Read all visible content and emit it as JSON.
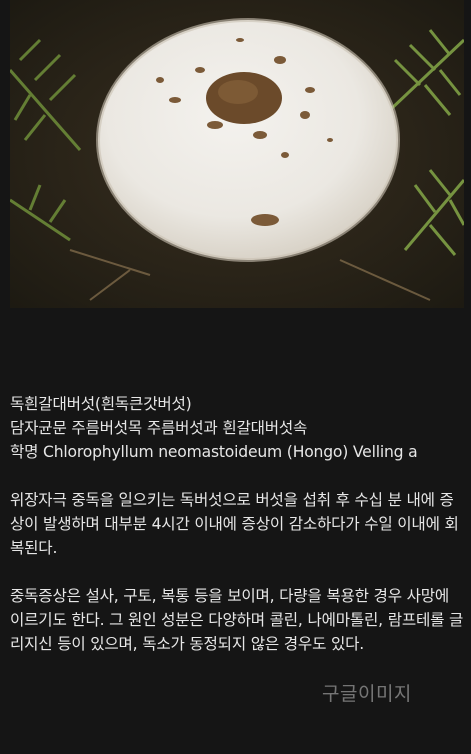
{
  "article": {
    "title": "독흰갈대버섯(흰독큰갓버섯)",
    "classification": "담자균문 주름버섯목 주름버섯과 흰갈대버섯속",
    "scientific_name": "학명 Chlorophyllum neomastoideum (Hongo) Velling a",
    "paragraphs": [
      "위장자극 중독을 일으키는 독버섯으로 버섯을 섭취 후 수십 분 내에 증상이 발생하며 대부분 4시간 이내에 증상이 감소하다가 수일 이내에 회복된다.",
      "중독증상은 설사, 구토, 복통 등을 보이며, 다량을 복용한 경우 사망에 이르기도 한다. 그 원인 성분은 다양하며 콜린, 나에마톨린, 람프테롤 글리지신 등이 있으며, 독소가 동정되지 않은 경우도 있다."
    ]
  },
  "photo": {
    "subject": "white mushroom cap with brown scales among ferns"
  },
  "watermark": "구글이미지"
}
